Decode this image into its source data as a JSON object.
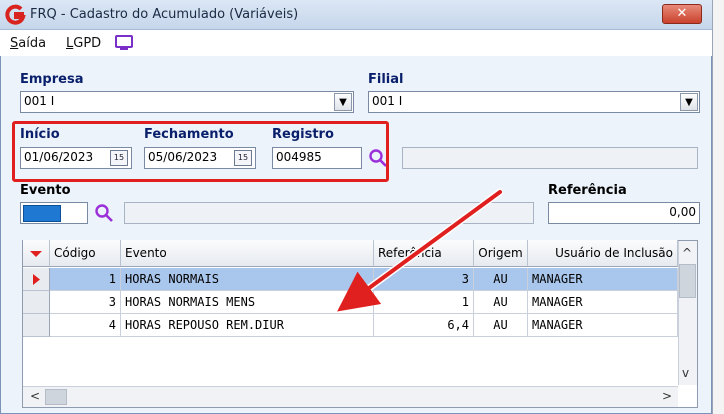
{
  "window": {
    "title": "FRQ - Cadastro do Acumulado (Variáveis)",
    "close_label": "✕"
  },
  "menu": {
    "saida_mnemonic": "S",
    "saida_rest": "aída",
    "lgpd_mnemonic": "L",
    "lgpd_rest": "GPD"
  },
  "form": {
    "empresa_label": "Empresa",
    "empresa_value": "001 I",
    "filial_label": "Filial",
    "filial_value": "001 I",
    "inicio_label": "Início",
    "inicio_value": "01/06/2023",
    "fechamento_label": "Fechamento",
    "fechamento_value": "05/06/2023",
    "registro_label": "Registro",
    "registro_value": "004985",
    "registro_desc": "",
    "evento_label": "Evento",
    "evento_desc": "",
    "referencia_label": "Referência",
    "referencia_value": "0,00",
    "calendar_glyph": "15",
    "dropdown_glyph": "▼"
  },
  "grid": {
    "columns": [
      "Código",
      "Evento",
      "Referência",
      "Origem",
      "Usuário de Inclusão"
    ],
    "rows": [
      {
        "codigo": "1",
        "evento": "HORAS NORMAIS",
        "referencia": "3",
        "origem": "AU",
        "usuario": "MANAGER",
        "selected": true
      },
      {
        "codigo": "3",
        "evento": "HORAS NORMAIS MENS",
        "referencia": "1",
        "origem": "AU",
        "usuario": "MANAGER",
        "selected": false
      },
      {
        "codigo": "4",
        "evento": "HORAS REPOUSO REM.DIUR",
        "referencia": "6,4",
        "origem": "AU",
        "usuario": "MANAGER",
        "selected": false
      }
    ]
  },
  "annotation": {
    "highlight_color": "#e01f1f",
    "arrow_color": "#e01f1f"
  },
  "icons": {
    "app": "app-logo-icon",
    "monitor": "monitor-icon",
    "search": "magnifier-icon",
    "calendar": "calendar-icon"
  }
}
